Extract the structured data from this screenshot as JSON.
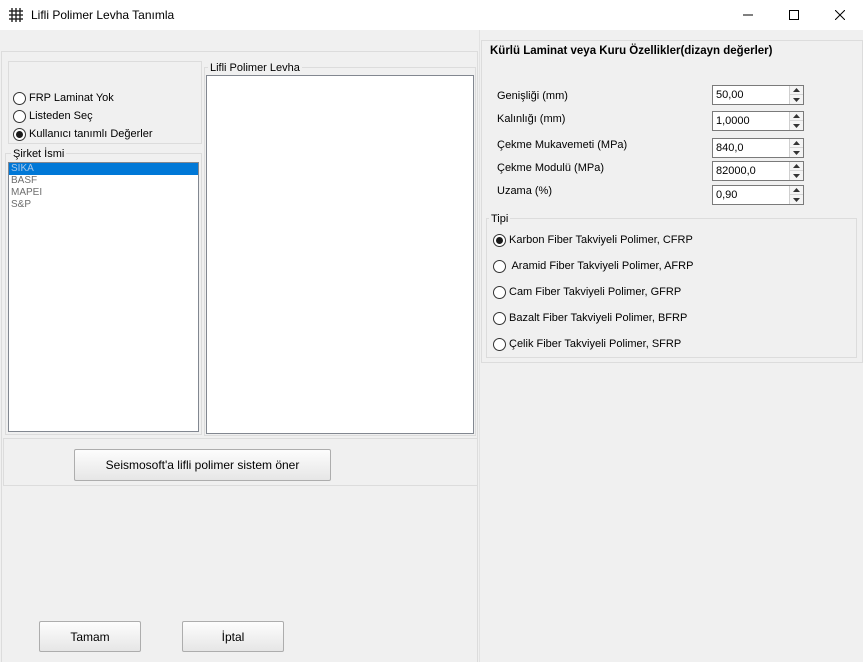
{
  "window": {
    "title": "Lifli Polimer Levha Tanımla",
    "controls": [
      "minimize-icon",
      "maximize-icon",
      "close-icon"
    ]
  },
  "frp_option": {
    "options": [
      {
        "label": "FRP Laminat Yok",
        "checked": false
      },
      {
        "label": "Listeden Seç",
        "checked": false
      },
      {
        "label": "Kullanıcı tanımlı Değerler",
        "checked": true
      }
    ]
  },
  "company": {
    "title": "Şirket İsmi",
    "items": [
      {
        "label": "SIKA",
        "selected": true
      },
      {
        "label": "BASF",
        "selected": false
      },
      {
        "label": "MAPEI",
        "selected": false
      },
      {
        "label": "S&P",
        "selected": false
      }
    ]
  },
  "laminate_list": {
    "title": "Lifli Polimer Levha"
  },
  "suggest_button": "Seismosoft'a lifli polimer sistem öner",
  "ok_button": "Tamam",
  "cancel_button": "İptal",
  "properties": {
    "title": "Kürlü Laminat veya Kuru Özellikler(dizayn değerler)",
    "fields": [
      {
        "label": "Genişliği (mm)",
        "value": "50,00"
      },
      {
        "label": "Kalınlığı (mm)",
        "value": "1,0000"
      },
      {
        "label": "Çekme Mukavemeti (MPa)",
        "value": "840,0"
      },
      {
        "label": "Çekme Modulü (MPa)",
        "value": "82000,0"
      },
      {
        "label": "Uzama (%)",
        "value": "0,90"
      }
    ]
  },
  "type": {
    "title": "Tipi",
    "options": [
      {
        "label": "Karbon Fiber Takviyeli Polimer, CFRP",
        "checked": true
      },
      {
        "label": " Aramid Fiber Takviyeli Polimer, AFRP",
        "checked": false
      },
      {
        "label": "Cam Fiber Takviyeli Polimer, GFRP",
        "checked": false
      },
      {
        "label": "Bazalt Fiber Takviyeli Polimer, BFRP",
        "checked": false
      },
      {
        "label": "Çelik Fiber Takviyeli Polimer, SFRP",
        "checked": false
      }
    ]
  }
}
